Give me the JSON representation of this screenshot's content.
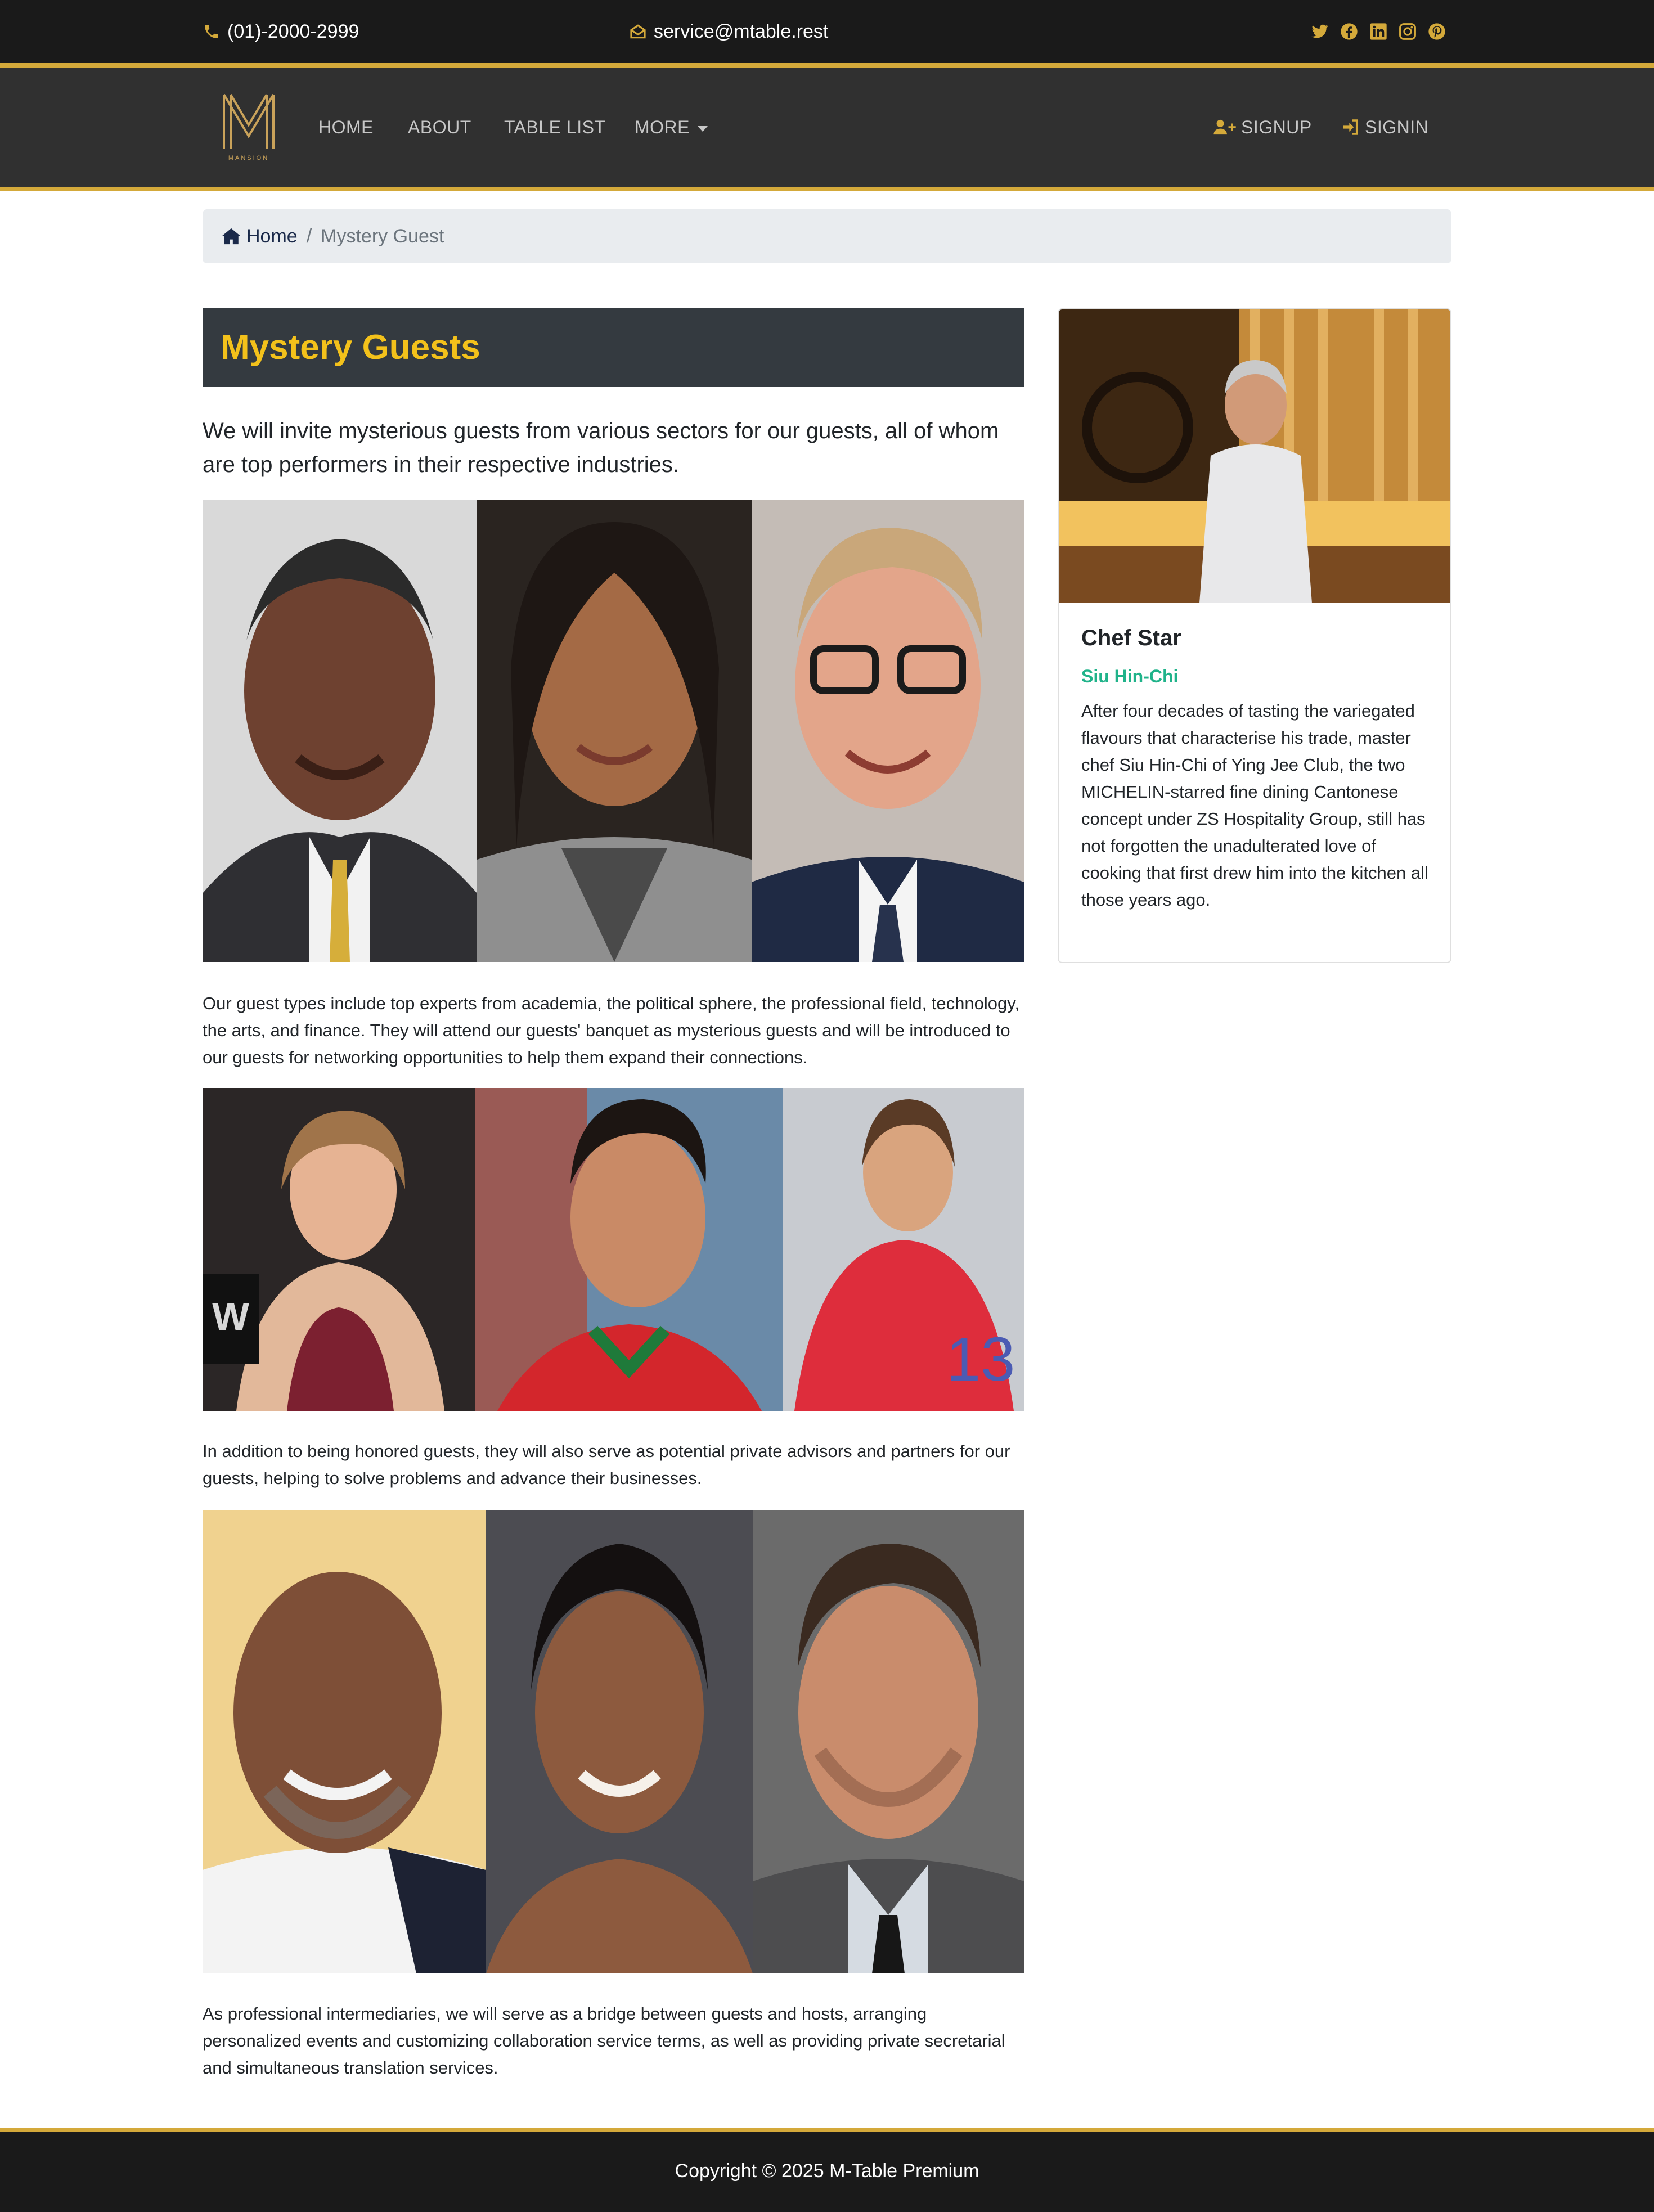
{
  "topbar": {
    "phone": "(01)-2000-2999",
    "email": "service@mtable.rest",
    "social_icons": [
      "twitter-icon",
      "facebook-icon",
      "linkedin-icon",
      "instagram-icon",
      "pinterest-icon"
    ]
  },
  "colors": {
    "accent_gold": "#d4a93a",
    "title_yellow": "#f3c11b",
    "dark_bg": "#1a1a1a",
    "nav_bg": "#303030",
    "subtitle_green": "#20b38a"
  },
  "navbar": {
    "logo_text": "MANSION",
    "links": [
      "HOME",
      "ABOUT",
      "TABLE LIST",
      "MORE"
    ],
    "signup": "SIGNUP",
    "signin": "SIGNIN"
  },
  "breadcrumb": {
    "home": "Home",
    "current": "Mystery Guest"
  },
  "main": {
    "title": "Mystery Guests",
    "lead": "We will invite mysterious guests from various sectors for our guests, all of whom are top performers in their respective industries.",
    "paragraphs": [
      "Our guest types include top experts from academia, the political sphere, the professional field, technology, the arts, and finance. They will attend our guests' banquet as mysterious guests and will be introduced to our guests for networking opportunities to help them expand their connections.",
      "In addition to being honored guests, they will also serve as potential private advisors and partners for our guests, helping to solve problems and advance their businesses.",
      "As professional intermediaries, we will serve as a bridge between guests and hosts, arranging personalized events and customizing collaboration service terms, as well as providing private secretarial and simultaneous translation services."
    ]
  },
  "sidebar": {
    "card_title": "Chef Star",
    "card_subtitle": "Siu Hin-Chi",
    "card_text": "After four decades of tasting the variegated flavours that characterise his trade, master chef Siu Hin-Chi of Ying Jee Club, the two MICHELIN-starred fine dining Cantonese concept under ZS Hospitality Group, still has not forgotten the unadulterated love of cooking that first drew him into the kitchen all those years ago."
  },
  "footer": {
    "copyright": "Copyright © 2025 M-Table Premium"
  }
}
